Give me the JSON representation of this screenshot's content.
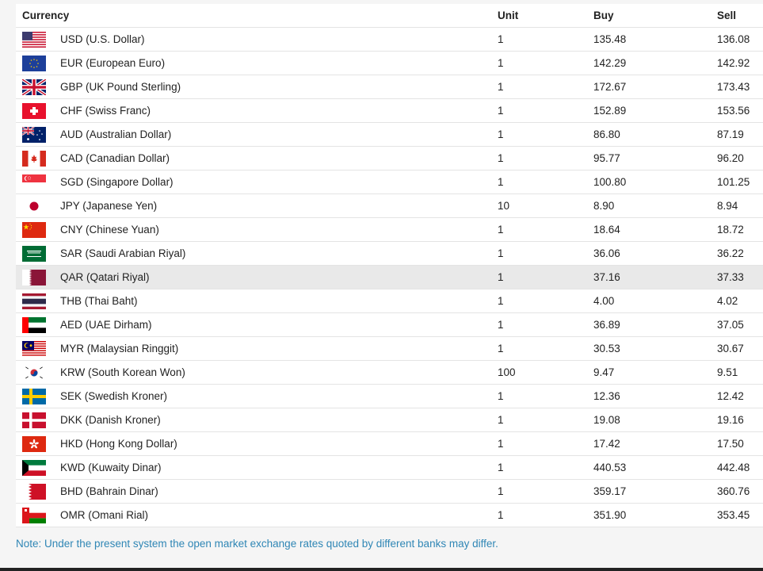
{
  "table": {
    "headers": {
      "currency": "Currency",
      "unit": "Unit",
      "buy": "Buy",
      "sell": "Sell"
    },
    "rows": [
      {
        "flag": "us-flag-icon",
        "currency": "USD (U.S. Dollar)",
        "unit": "1",
        "buy": "135.48",
        "sell": "136.08"
      },
      {
        "flag": "eu-flag-icon",
        "currency": "EUR (European Euro)",
        "unit": "1",
        "buy": "142.29",
        "sell": "142.92"
      },
      {
        "flag": "gb-flag-icon",
        "currency": "GBP (UK Pound Sterling)",
        "unit": "1",
        "buy": "172.67",
        "sell": "173.43"
      },
      {
        "flag": "ch-flag-icon",
        "currency": "CHF (Swiss Franc)",
        "unit": "1",
        "buy": "152.89",
        "sell": "153.56"
      },
      {
        "flag": "au-flag-icon",
        "currency": "AUD (Australian Dollar)",
        "unit": "1",
        "buy": "86.80",
        "sell": "87.19"
      },
      {
        "flag": "ca-flag-icon",
        "currency": "CAD (Canadian Dollar)",
        "unit": "1",
        "buy": "95.77",
        "sell": "96.20"
      },
      {
        "flag": "sg-flag-icon",
        "currency": "SGD (Singapore Dollar)",
        "unit": "1",
        "buy": "100.80",
        "sell": "101.25"
      },
      {
        "flag": "jp-flag-icon",
        "currency": "JPY (Japanese Yen)",
        "unit": "10",
        "buy": "8.90",
        "sell": "8.94"
      },
      {
        "flag": "cn-flag-icon",
        "currency": "CNY (Chinese Yuan)",
        "unit": "1",
        "buy": "18.64",
        "sell": "18.72"
      },
      {
        "flag": "sa-flag-icon",
        "currency": "SAR (Saudi Arabian Riyal)",
        "unit": "1",
        "buy": "36.06",
        "sell": "36.22"
      },
      {
        "flag": "qa-flag-icon",
        "currency": "QAR (Qatari Riyal)",
        "unit": "1",
        "buy": "37.16",
        "sell": "37.33"
      },
      {
        "flag": "th-flag-icon",
        "currency": "THB (Thai Baht)",
        "unit": "1",
        "buy": "4.00",
        "sell": "4.02"
      },
      {
        "flag": "ae-flag-icon",
        "currency": "AED (UAE Dirham)",
        "unit": "1",
        "buy": "36.89",
        "sell": "37.05"
      },
      {
        "flag": "my-flag-icon",
        "currency": "MYR (Malaysian Ringgit)",
        "unit": "1",
        "buy": "30.53",
        "sell": "30.67"
      },
      {
        "flag": "kr-flag-icon",
        "currency": "KRW (South Korean Won)",
        "unit": "100",
        "buy": "9.47",
        "sell": "9.51"
      },
      {
        "flag": "se-flag-icon",
        "currency": "SEK (Swedish Kroner)",
        "unit": "1",
        "buy": "12.36",
        "sell": "12.42"
      },
      {
        "flag": "dk-flag-icon",
        "currency": "DKK (Danish Kroner)",
        "unit": "1",
        "buy": "19.08",
        "sell": "19.16"
      },
      {
        "flag": "hk-flag-icon",
        "currency": "HKD (Hong Kong Dollar)",
        "unit": "1",
        "buy": "17.42",
        "sell": "17.50"
      },
      {
        "flag": "kw-flag-icon",
        "currency": "KWD (Kuwaity Dinar)",
        "unit": "1",
        "buy": "440.53",
        "sell": "442.48"
      },
      {
        "flag": "bh-flag-icon",
        "currency": "BHD (Bahrain Dinar)",
        "unit": "1",
        "buy": "359.17",
        "sell": "360.76"
      },
      {
        "flag": "om-flag-icon",
        "currency": "OMR (Omani Rial)",
        "unit": "1",
        "buy": "351.90",
        "sell": "353.45"
      }
    ]
  },
  "note": "Note: Under the present system the open market exchange rates quoted by different banks may differ.",
  "colors": {
    "note": "#2f86b5",
    "highlight_row": "#e9e9e9",
    "border": "#e4e4e4"
  }
}
